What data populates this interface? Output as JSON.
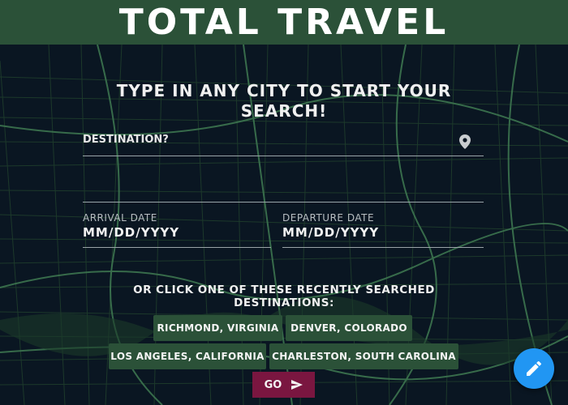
{
  "header": {
    "title": "TOTAL TRAVEL"
  },
  "search": {
    "headline": "TYPE IN ANY CITY TO START YOUR SEARCH!",
    "destination_label": "DESTINATION?",
    "location_icon": "map-pin-icon",
    "arrival_label": "ARRIVAL DATE",
    "arrival_value": "MM/DD/YYYY",
    "departure_label": "DEPARTURE DATE",
    "departure_value": "MM/DD/YYYY"
  },
  "recent": {
    "heading": "OR CLICK ONE OF THESE RECENTLY SEARCHED DESTINATIONS:",
    "destinations": [
      "RICHMOND, VIRGINIA",
      "DENVER, COLORADO",
      "LOS ANGELES, CALIFORNIA",
      "CHARLESTON, SOUTH CAROLINA"
    ]
  },
  "go_button": {
    "label": "GO",
    "icon": "send-icon"
  },
  "fab": {
    "icon": "edit-pencil-icon"
  },
  "colors": {
    "header_bg": "#2b5138",
    "chip_bg": "#2b5138",
    "go_bg": "#7a1640",
    "fab_bg": "#2196f3",
    "map_bg": "#0a1622",
    "map_roads": "#3f7a52"
  }
}
